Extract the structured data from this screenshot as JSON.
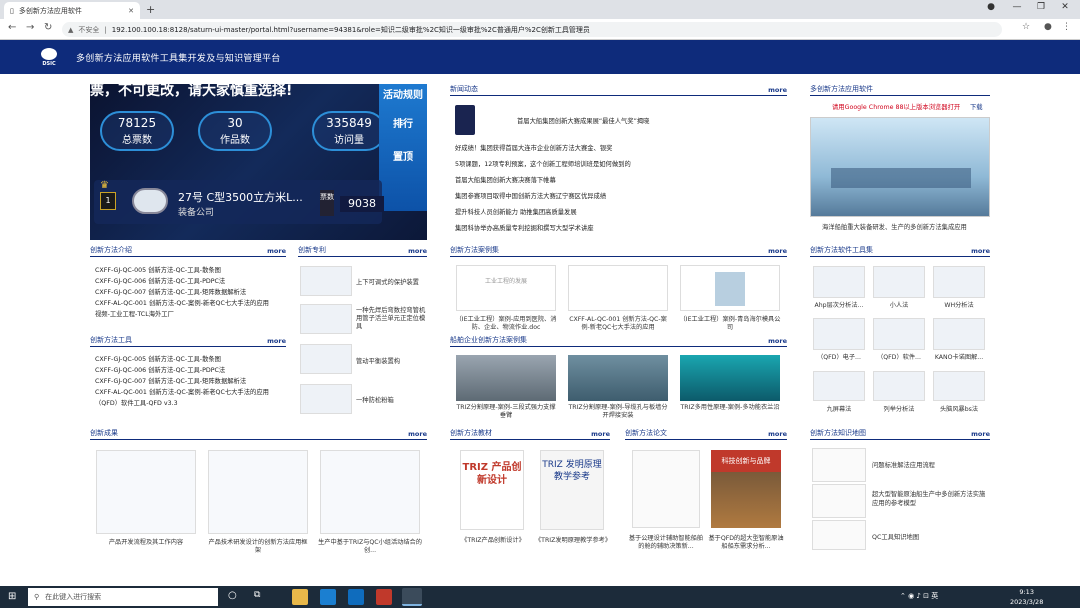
{
  "browser": {
    "tab_title": "多创新方法应用软件",
    "new_tab": "+",
    "security": "不安全",
    "url": "192.100.100.18:8128/saturn-ui-master/portal.html?username=94381&role=知识二级审批%2C知识一级审批%2C普通用户%2C创新工具管理员"
  },
  "header": {
    "logo_text": "DSIC",
    "title": "多创新方法应用软件工具集开发及与知识管理平台"
  },
  "banner": {
    "top_text": "票，不可更改，请大家慎重选择!",
    "stats": [
      {
        "value": "78125",
        "label": "总票数"
      },
      {
        "value": "30",
        "label": "作品数"
      },
      {
        "value": "335849",
        "label": "访问量"
      }
    ],
    "side_buttons": [
      "活动规则",
      "排行",
      "置顶"
    ],
    "rank": "1",
    "entry_name": "27号 C型3500立方米L...",
    "entry_company": "装备公司",
    "vote_label": "票数",
    "vote_count": "9038"
  },
  "news": {
    "title": "新闻动态",
    "more": "more",
    "items": [
      "首届大船集团创新大赛成果展“最佳人气奖”揭晓",
      "好成绩！集团获得首届大连市企业创新方法大赛金、银奖",
      "5项课题，12项专利预案，这个创新工程师培训班是如何做到的",
      "首届大船集团创新大赛决赛落下帷幕",
      "集团参赛项目取得中国创新方法大赛辽宁赛区优异成绩",
      "提升科技人员创新能力 助推集团高质量发展",
      "集团科协举办高质量专利挖掘和撰写大型学术讲座"
    ]
  },
  "software": {
    "title": "多创新方法应用软件",
    "notice": "请用Google Chrome 88以上版本浏览器打开",
    "download": "下载",
    "caption": "海洋船舶重大装备研发、生产的多创新方法集成应用"
  },
  "intro": {
    "title": "创新方法介绍",
    "more": "more",
    "items": [
      "CXFF-GJ-QC-005 创新方法-QC-工具-散条图",
      "CXFF-GJ-QC-006 创新方法-QC-工具-PDPC法",
      "CXFF-GJ-QC-007 创新方法-QC-工具-矩阵数据解析法",
      "CXFF-AL-QC-001 创新方法-QC-案例-新老QC七大手法的应用",
      "视频-工业工程-TCL海外工厂"
    ]
  },
  "tools": {
    "title": "创新方法工具",
    "more": "more",
    "items": [
      "CXFF-GJ-QC-005 创新方法-QC-工具-散条图",
      "CXFF-GJ-QC-006 创新方法-QC-工具-PDPC法",
      "CXFF-GJ-QC-007 创新方法-QC-工具-矩阵数据解析法",
      "CXFF-AL-QC-001 创新方法-QC-案例-新老QC七大手法的应用",
      "（QFD）软件工具-QFD v3.3"
    ]
  },
  "patent": {
    "title": "创新专利",
    "more": "more",
    "items": [
      "上下可调式的保护装置",
      "一种先焊后弯数控弯管机用管子活兰单元正定位模具",
      "管动平衡装置构",
      "一种防松粉箱"
    ]
  },
  "cases": {
    "title": "创新方法案例集",
    "more": "more",
    "items": [
      "（IE工业工程）案例-应用到医院、消防、企业、物流作业.doc",
      "CXFF-AL-QC-001 创新方法-QC-案例-新老QC七大手法的应用",
      "（IE工业工程）案例-青岛海尔模具公司"
    ],
    "thumb_text": "工业工程的发展"
  },
  "ship": {
    "title": "船舶企业创新方法案例集",
    "more": "more",
    "items": [
      "TRIZ分割原理-案例-三段式强力支撑垂臂",
      "TRIZ分割原理-案例-导缆孔与板墙分开焊接安装",
      "TRIZ多用性原理-案例-多功能衣兰沿"
    ]
  },
  "toolset": {
    "title": "创新方法软件工具集",
    "more": "more",
    "items": [
      "Ahp层次分析法...",
      "小人法",
      "WH分析法",
      "（QFD）电子...",
      "（QFD）软件...",
      "KANO卡诺图解...",
      "九屏幕法",
      "列举分析法",
      "头脑风暴bs法"
    ]
  },
  "results": {
    "title": "创新成果",
    "more": "more",
    "items": [
      "产品开发流程及其工作内容",
      "产品技术研发设计的创新方法应用框架",
      "生产中基于TRIZ与QC小组活动结合的创..."
    ]
  },
  "textbooks": {
    "title": "创新方法教材",
    "more": "more",
    "items": [
      "《TRIZ产品创新设计》",
      "《TRIZ发明原理教学参考》"
    ],
    "cover1": "TRIZ 产品创新设计",
    "cover2": "TRIZ 发明原理教学参考"
  },
  "papers": {
    "title": "创新方法论文",
    "more": "more",
    "items": [
      "基于公理设计辅助智能船舶的舱的辅助决策新...",
      "基于QFD的超大型智能原油船船东需求分析..."
    ],
    "cover2": "科技创新与品牌"
  },
  "knowledge": {
    "title": "创新方法知识地图",
    "more": "more",
    "items": [
      "问题标准解法应用流程",
      "超大型智能原油船生产中多创新方法实施应用的参考模型",
      "QC工具知识地图"
    ]
  },
  "taskbar": {
    "search_placeholder": "在此键入进行搜索",
    "time": "9:13",
    "date": "2023/3/28"
  }
}
